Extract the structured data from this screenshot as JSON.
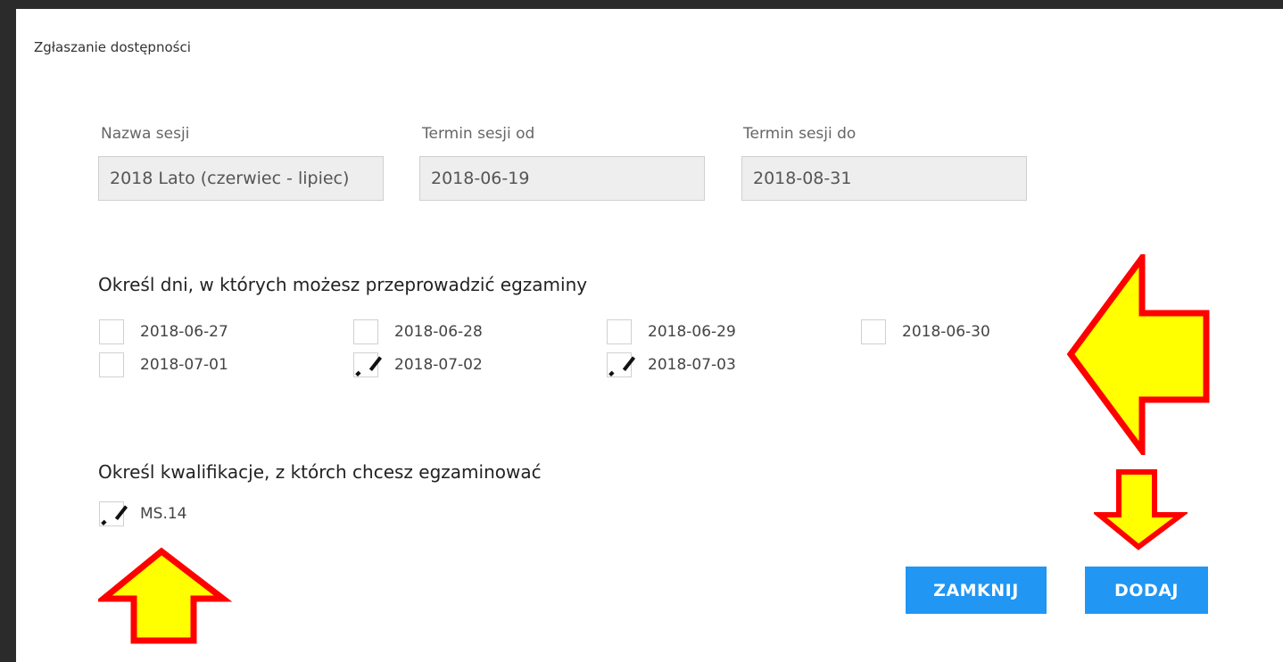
{
  "dialog": {
    "title": "Zgłaszanie dostępności"
  },
  "fields": [
    {
      "label": "Nazwa sesji",
      "value": "2018 Lato (czerwiec - lipiec)"
    },
    {
      "label": "Termin sesji od",
      "value": "2018-06-19"
    },
    {
      "label": "Termin sesji do",
      "value": "2018-08-31"
    }
  ],
  "days": {
    "heading": "Określ dni, w których możesz przeprowadzić egzaminy",
    "items": [
      {
        "label": "2018-06-27",
        "checked": false
      },
      {
        "label": "2018-06-28",
        "checked": false
      },
      {
        "label": "2018-06-29",
        "checked": false
      },
      {
        "label": "2018-06-30",
        "checked": false
      },
      {
        "label": "2018-07-01",
        "checked": false
      },
      {
        "label": "2018-07-02",
        "checked": true
      },
      {
        "label": "2018-07-03",
        "checked": true
      }
    ]
  },
  "qualifications": {
    "heading": "Określ kwalifikacje, z którch chcesz egzaminować",
    "items": [
      {
        "label": "MS.14",
        "checked": true
      }
    ]
  },
  "buttons": {
    "close_label": "ZAMKNIJ",
    "add_label": "DODAJ"
  },
  "colors": {
    "button": "#2196f3",
    "arrow_fill": "#ffff00",
    "arrow_stroke": "#ff0000"
  }
}
